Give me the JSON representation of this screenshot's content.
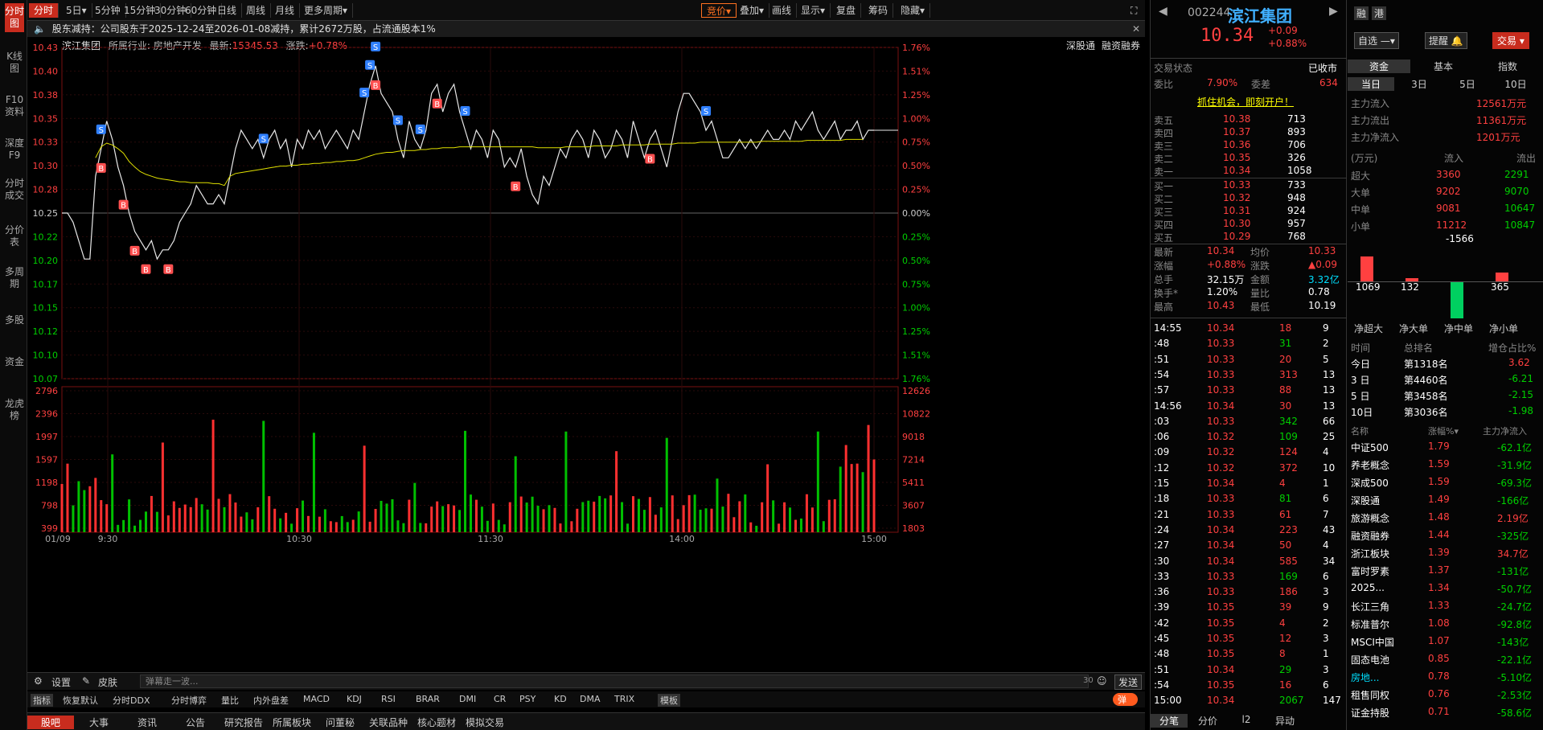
{
  "leftnav": [
    "分时图",
    "K线图",
    "F10资料",
    "深度F9",
    "分时成交",
    "分价表",
    "多周期",
    "多股",
    "资金",
    "龙虎榜"
  ],
  "topbar": {
    "items": [
      "分时",
      "5日▾",
      "5分钟",
      "15分钟",
      "30分钟",
      "60分钟",
      "日线",
      "周线",
      "月线",
      "更多周期▾"
    ],
    "right": [
      "竞价▾",
      "叠加▾",
      "画线",
      "显示▾",
      "复盘",
      "筹码",
      "隐藏▾"
    ]
  },
  "notice": "股东减持：公司股东于2025-12-24至2026-01-08减持，累计2672万股，占流通股本1%",
  "info": {
    "name": "滨江集团",
    "industry": "所属行业: 房地产开发",
    "latest_label": "最新:",
    "latest": "15345.53",
    "chg_label": "涨跌:",
    "chg": "+0.78%",
    "links": [
      "深股通",
      "融资融券"
    ]
  },
  "chart_data": {
    "type": "line",
    "title": "",
    "y_left": [
      "10.43",
      "10.40",
      "10.38",
      "10.35",
      "10.33",
      "10.30",
      "10.28",
      "10.25",
      "10.22",
      "10.20",
      "10.17",
      "10.15",
      "10.12",
      "10.10",
      "10.07"
    ],
    "y_right": [
      "1.76%",
      "1.51%",
      "1.25%",
      "1.00%",
      "0.75%",
      "0.50%",
      "0.25%",
      "0.00%",
      "0.25%",
      "0.50%",
      "0.75%",
      "1.00%",
      "1.25%",
      "1.51%",
      "1.76%"
    ],
    "ylim": [
      10.07,
      10.43
    ],
    "prev_close": 10.25,
    "x_labels": [
      "01/09",
      "9:30",
      "10:30",
      "11:30",
      "14:00",
      "15:00"
    ],
    "price": [
      10.25,
      10.25,
      10.24,
      10.22,
      10.2,
      10.2,
      10.29,
      10.32,
      10.35,
      10.33,
      10.3,
      10.28,
      10.25,
      10.23,
      10.22,
      10.21,
      10.22,
      10.2,
      10.21,
      10.21,
      10.22,
      10.24,
      10.25,
      10.26,
      10.28,
      10.27,
      10.26,
      10.26,
      10.27,
      10.26,
      10.29,
      10.32,
      10.34,
      10.33,
      10.32,
      10.33,
      10.31,
      10.33,
      10.34,
      10.32,
      10.33,
      10.3,
      10.33,
      10.32,
      10.34,
      10.33,
      10.34,
      10.32,
      10.33,
      10.34,
      10.33,
      10.32,
      10.34,
      10.33,
      10.36,
      10.39,
      10.41,
      10.38,
      10.37,
      10.36,
      10.33,
      10.31,
      10.35,
      10.33,
      10.32,
      10.34,
      10.38,
      10.39,
      10.36,
      10.38,
      10.39,
      10.36,
      10.34,
      10.32,
      10.34,
      10.33,
      10.31,
      10.34,
      10.33,
      10.3,
      10.31,
      10.3,
      10.32,
      10.29,
      10.27,
      10.26,
      10.29,
      10.28,
      10.3,
      10.32,
      10.31,
      10.33,
      10.34,
      10.33,
      10.31,
      10.34,
      10.33,
      10.31,
      10.32,
      10.34,
      10.33,
      10.31,
      10.35,
      10.33,
      10.31,
      10.33,
      10.34,
      10.32,
      10.3,
      10.33,
      10.36,
      10.38,
      10.38,
      10.37,
      10.36,
      10.34,
      10.35,
      10.33,
      10.31,
      10.31,
      10.32,
      10.33,
      10.32,
      10.33,
      10.32,
      10.33,
      10.34,
      10.33,
      10.33,
      10.34,
      10.33,
      10.35,
      10.34,
      10.35,
      10.36,
      10.34,
      10.33,
      10.34,
      10.35,
      10.33,
      10.34,
      10.34,
      10.35,
      10.33,
      10.34,
      10.34
    ],
    "avg": [
      null,
      null,
      null,
      null,
      null,
      null,
      10.31,
      10.322,
      10.326,
      10.324,
      10.32,
      10.315,
      10.306,
      10.3,
      10.295,
      10.292,
      10.29,
      10.288,
      10.287,
      10.286,
      10.285,
      10.284,
      10.284,
      10.283,
      10.283,
      10.283,
      10.283,
      10.282,
      10.282,
      10.28,
      10.29,
      10.293,
      10.294,
      10.295,
      10.296,
      10.297,
      10.298,
      10.299,
      10.3,
      10.301,
      10.301,
      10.302,
      10.302,
      10.303,
      10.303,
      10.304,
      10.304,
      10.305,
      10.305,
      10.306,
      10.306,
      10.307,
      10.307,
      10.308,
      10.31,
      10.312,
      10.314,
      10.315,
      10.316,
      10.316,
      10.317,
      10.318,
      10.318,
      10.318,
      10.319,
      10.319,
      10.32,
      10.32,
      10.321,
      10.321,
      10.321,
      10.322,
      10.322,
      10.322,
      10.322,
      10.322,
      10.322,
      10.322,
      10.322,
      10.322,
      10.322,
      10.322,
      10.322,
      10.322,
      10.322,
      10.321,
      10.321,
      10.321,
      10.321,
      10.321,
      10.322,
      10.322,
      10.322,
      10.322,
      10.322,
      10.323,
      10.323,
      10.323,
      10.323,
      10.323,
      10.324,
      10.324,
      10.324,
      10.324,
      10.324,
      10.325,
      10.325,
      10.325,
      10.325,
      10.325,
      10.326,
      10.326,
      10.326,
      10.326,
      10.327,
      10.327,
      10.327,
      10.327,
      10.327,
      10.327,
      10.327,
      10.327,
      10.327,
      10.327,
      10.327,
      10.328,
      10.328,
      10.328,
      10.328,
      10.328,
      10.328,
      10.328,
      10.328,
      10.329,
      10.329,
      10.329,
      10.329,
      10.329,
      10.329,
      10.329,
      10.33,
      10.33,
      10.33,
      10.33
    ],
    "vol_y_left": [
      "2796",
      "2396",
      "1997",
      "1597",
      "1198",
      "798",
      "399"
    ],
    "vol_y_right": [
      "12626",
      "10822",
      "9018",
      "7214",
      "5411",
      "3607",
      "1803"
    ],
    "buy_marks": [
      7,
      11,
      13,
      15,
      19,
      56,
      67,
      81,
      105
    ],
    "sell_marks": [
      7,
      36,
      54,
      55,
      56,
      60,
      64,
      72,
      115
    ]
  },
  "bottom": {
    "settings": "设置",
    "skin": "皮肤",
    "danmu_placeholder": "弹幕走一波...",
    "count": "30",
    "send": "发送",
    "indicators": [
      "指标",
      "恢复默认",
      "分时DDX",
      "分时博弈",
      "量比",
      "内外盘差",
      "MACD",
      "KDJ",
      "RSI",
      "BRAR",
      "DMI",
      "CR",
      "PSY",
      "KD",
      "DMA",
      "TRIX",
      "模板"
    ],
    "danmu_toggle": "弹",
    "tabs": [
      "股吧",
      "大事",
      "资讯",
      "公告",
      "研究报告",
      "所属板块",
      "问董秘",
      "关联品种",
      "核心题材",
      "模拟交易"
    ]
  },
  "quote": {
    "code": "002244",
    "name": "滨江集团",
    "price": "10.34",
    "chg": "+0.09",
    "pct": "+0.88%",
    "buttons": [
      "融",
      "港"
    ],
    "actions": [
      "自选 —▾",
      "提醒 🔔",
      "交易 ▾"
    ],
    "status_label": "交易状态",
    "status": "已收市",
    "weibi_label": "委比",
    "weibi": "7.90%",
    "weicha_label": "委差",
    "weicha": "634",
    "ad": "抓住机会，即刻开户！",
    "asks": [
      [
        "卖五",
        "10.38",
        "713"
      ],
      [
        "卖四",
        "10.37",
        "893"
      ],
      [
        "卖三",
        "10.36",
        "706"
      ],
      [
        "卖二",
        "10.35",
        "326"
      ],
      [
        "卖一",
        "10.34",
        "1058"
      ]
    ],
    "bids": [
      [
        "买一",
        "10.33",
        "733"
      ],
      [
        "买二",
        "10.32",
        "948"
      ],
      [
        "买三",
        "10.31",
        "924"
      ],
      [
        "买四",
        "10.30",
        "957"
      ],
      [
        "买五",
        "10.29",
        "768"
      ]
    ],
    "stats": [
      [
        "最新",
        "10.34",
        "均价",
        "10.33"
      ],
      [
        "涨幅",
        "+0.88%",
        "涨跌",
        "▲0.09"
      ],
      [
        "总手",
        "32.15万",
        "金额",
        "3.32亿"
      ],
      [
        "换手*",
        "1.20%",
        "量比",
        "0.78"
      ],
      [
        "最高",
        "10.43",
        "最低",
        "10.19"
      ]
    ],
    "ticks": [
      [
        "14:55",
        "10.34",
        "18",
        "9"
      ],
      [
        ":48",
        "10.33",
        "31",
        "2"
      ],
      [
        ":51",
        "10.33",
        "20",
        "5"
      ],
      [
        ":54",
        "10.33",
        "313",
        "13"
      ],
      [
        ":57",
        "10.33",
        "88",
        "13"
      ],
      [
        "14:56",
        "10.34",
        "30",
        "13"
      ],
      [
        ":03",
        "10.33",
        "342",
        "66"
      ],
      [
        ":06",
        "10.32",
        "109",
        "25"
      ],
      [
        ":09",
        "10.32",
        "124",
        "4"
      ],
      [
        ":12",
        "10.32",
        "372",
        "10"
      ],
      [
        ":15",
        "10.34",
        "4",
        "1"
      ],
      [
        ":18",
        "10.33",
        "81",
        "6"
      ],
      [
        ":21",
        "10.33",
        "61",
        "7"
      ],
      [
        ":24",
        "10.34",
        "223",
        "43"
      ],
      [
        ":27",
        "10.34",
        "50",
        "4"
      ],
      [
        ":30",
        "10.34",
        "585",
        "34"
      ],
      [
        ":33",
        "10.33",
        "169",
        "6"
      ],
      [
        ":36",
        "10.33",
        "186",
        "3"
      ],
      [
        ":39",
        "10.35",
        "39",
        "9"
      ],
      [
        ":42",
        "10.35",
        "4",
        "2"
      ],
      [
        ":45",
        "10.35",
        "12",
        "3"
      ],
      [
        ":48",
        "10.35",
        "8",
        "1"
      ],
      [
        ":51",
        "10.34",
        "29",
        "3"
      ],
      [
        ":54",
        "10.35",
        "16",
        "6"
      ],
      [
        "15:00",
        "10.34",
        "2067",
        "147"
      ]
    ],
    "tick_tabs": [
      "分笔",
      "分价",
      "l2",
      "异动"
    ]
  },
  "flow": {
    "tabs": [
      "资金",
      "基本",
      "指数"
    ],
    "periods": [
      "当日",
      "3日",
      "5日",
      "10日"
    ],
    "main": [
      [
        "主力流入",
        "12561万元"
      ],
      [
        "主力流出",
        "11361万元"
      ],
      [
        "主力净流入",
        "1201万元"
      ]
    ],
    "unit": "(万元)",
    "head": [
      "流入",
      "流出"
    ],
    "table": [
      [
        "超大",
        "3360",
        "2291"
      ],
      [
        "大单",
        "9202",
        "9070"
      ],
      [
        "中单",
        "9081",
        "10647"
      ],
      [
        "小单",
        "11212",
        "10847"
      ]
    ],
    "bars": [
      {
        "label": "净超大",
        "value": 1069
      },
      {
        "label": "净大单",
        "value": 132
      },
      {
        "label": "净中单",
        "value": -1566
      },
      {
        "label": "净小单",
        "value": 365
      }
    ],
    "rank_head": [
      "时间",
      "总排名",
      "增仓占比%"
    ],
    "rank": [
      [
        "今日",
        "第1318名",
        "3.62"
      ],
      [
        "3 日",
        "第4460名",
        "-6.21"
      ],
      [
        "5 日",
        "第3458名",
        "-2.15"
      ],
      [
        "10日",
        "第3036名",
        "-1.98"
      ]
    ],
    "sector_head": [
      "名称",
      "涨幅%▾",
      "主力净流入"
    ],
    "sectors": [
      [
        "中证500",
        "1.79",
        "-62.1亿"
      ],
      [
        "养老概念",
        "1.59",
        "-31.9亿"
      ],
      [
        "深成500",
        "1.59",
        "-69.3亿"
      ],
      [
        "深股通",
        "1.49",
        "-166亿"
      ],
      [
        "旅游概念",
        "1.48",
        "2.19亿"
      ],
      [
        "融资融券",
        "1.44",
        "-325亿"
      ],
      [
        "浙江板块",
        "1.39",
        "34.7亿"
      ],
      [
        "富时罗素",
        "1.37",
        "-131亿"
      ],
      [
        "2025...",
        "1.34",
        "-50.7亿"
      ],
      [
        "长江三角",
        "1.33",
        "-24.7亿"
      ],
      [
        "标准普尔",
        "1.08",
        "-92.8亿"
      ],
      [
        "MSCI中国",
        "1.07",
        "-143亿"
      ],
      [
        "固态电池",
        "0.85",
        "-22.1亿"
      ],
      [
        "房地...",
        "0.78",
        "-5.10亿"
      ],
      [
        "租售同权",
        "0.76",
        "-2.53亿"
      ],
      [
        "证金持股",
        "0.71",
        "-58.6亿"
      ]
    ]
  }
}
